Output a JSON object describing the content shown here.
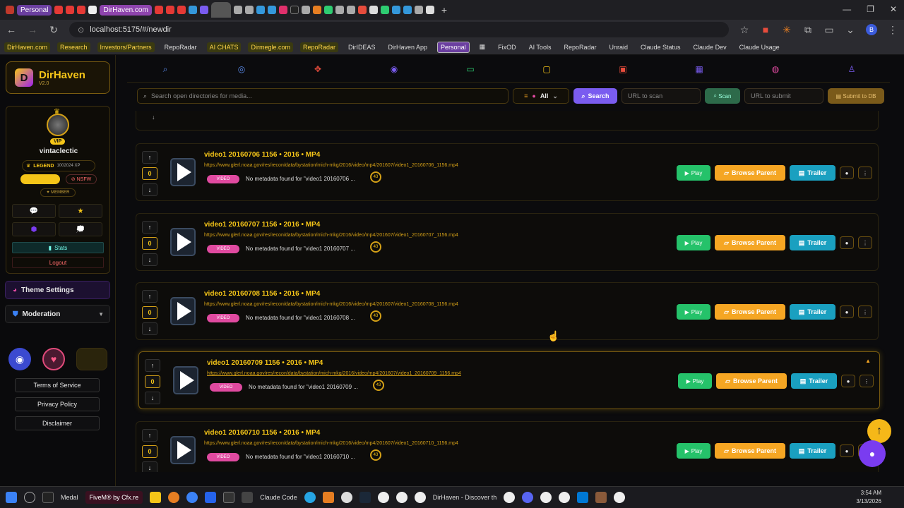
{
  "browser": {
    "tab_pills": [
      "Personal",
      "DirHaven.com"
    ],
    "url": "localhost:5175/#/newdir",
    "window_controls": [
      "—",
      "❐",
      "✕"
    ],
    "bookmarks": [
      "DirHaven.com",
      "Research",
      "Investors/Partners",
      "RepoRadar",
      "AI CHATS",
      "Dirmegle.com",
      "RepoRadar",
      "DirIDEAS",
      "DirHaven App",
      "Personal",
      "FixOD",
      "AI Tools",
      "RepoRadar",
      "Unraid",
      "Claude Status",
      "Claude Dev",
      "Claude Usage"
    ]
  },
  "sidebar": {
    "logo_letter": "D",
    "app_name": "DirHaven",
    "version": "V2.0",
    "username": "vintaclectic",
    "vip_label": "VIP",
    "rank_label": "LEGEND",
    "xp": "1002024 XP",
    "nsfw_label": "NSFW",
    "member_label": "✦ MEMBER",
    "stats_label": "Stats",
    "logout_label": "Logout",
    "theme_settings_label": "Theme Settings",
    "moderation_label": "Moderation",
    "legal_links": [
      "Terms of Service",
      "Privacy Policy",
      "Disclaimer"
    ]
  },
  "top_nav": {
    "icons": [
      "search-icon",
      "explore-icon",
      "crosshair-icon",
      "target-icon",
      "card-icon",
      "tv-icon",
      "video-icon",
      "grid-icon",
      "globe-icon",
      "user-icon"
    ]
  },
  "search": {
    "placeholder": "Search open directories for media...",
    "filter_label": "All",
    "search_button": "Search",
    "scan_placeholder": "URL to scan",
    "scan_button": "Scan",
    "submit_placeholder": "URL to submit",
    "submit_button": "Submit to DB"
  },
  "results": [
    {
      "title": "video1 20160706 1156 • 2016 • MP4",
      "url": "https://www.glerl.noaa.gov/res/recon/data/bystation/mich-mkg/2016/video/mp4/201607/video1_20160706_1156.mp4",
      "badge": "VIDEO",
      "metadata": "No metadata found for \"video1 20160706 ...",
      "score": "0",
      "ring": "43"
    },
    {
      "title": "video1 20160707 1156 • 2016 • MP4",
      "url": "https://www.glerl.noaa.gov/res/recon/data/bystation/mich-mkg/2016/video/mp4/201607/video1_20160707_1156.mp4",
      "badge": "VIDEO",
      "metadata": "No metadata found for \"video1 20160707 ...",
      "score": "0",
      "ring": "43"
    },
    {
      "title": "video1 20160708 1156 • 2016 • MP4",
      "url": "https://www.glerl.noaa.gov/res/recon/data/bystation/mich-mkg/2016/video/mp4/201607/video1_20160708_1156.mp4",
      "badge": "VIDEO",
      "metadata": "No metadata found for \"video1 20160708 ...",
      "score": "0",
      "ring": "43"
    },
    {
      "title": "video1 20160709 1156 • 2016 • MP4",
      "url": "https://www.glerl.noaa.gov/res/recon/data/bystation/mich-mkg/2016/video/mp4/201607/video1_20160709_1156.mp4",
      "badge": "VIDEO",
      "metadata": "No metadata found for \"video1 20160709 ...",
      "score": "0",
      "ring": "43"
    },
    {
      "title": "video1 20160710 1156 • 2016 • MP4",
      "url": "https://www.glerl.noaa.gov/res/recon/data/bystation/mich-mkg/2016/video/mp4/201607/video1_20160710_1156.mp4",
      "badge": "VIDEO",
      "metadata": "No metadata found for \"video1 20160710 ...",
      "score": "0",
      "ring": "43"
    }
  ],
  "actions": {
    "play": "Play",
    "browse_parent": "Browse Parent",
    "trailer": "Trailer"
  },
  "taskbar": {
    "items": [
      "Medal",
      "FiveM® by Cfx.re",
      "Claude Code",
      "DirHaven - Discover th"
    ],
    "time": "3:54 AM",
    "date": "3/13/2026"
  },
  "colors": {
    "accent_gold": "#f5c518",
    "play_green": "#25c26a",
    "browse_orange": "#f5a623",
    "trailer_teal": "#1aa0c0",
    "search_purple": "#7a5cf0"
  }
}
